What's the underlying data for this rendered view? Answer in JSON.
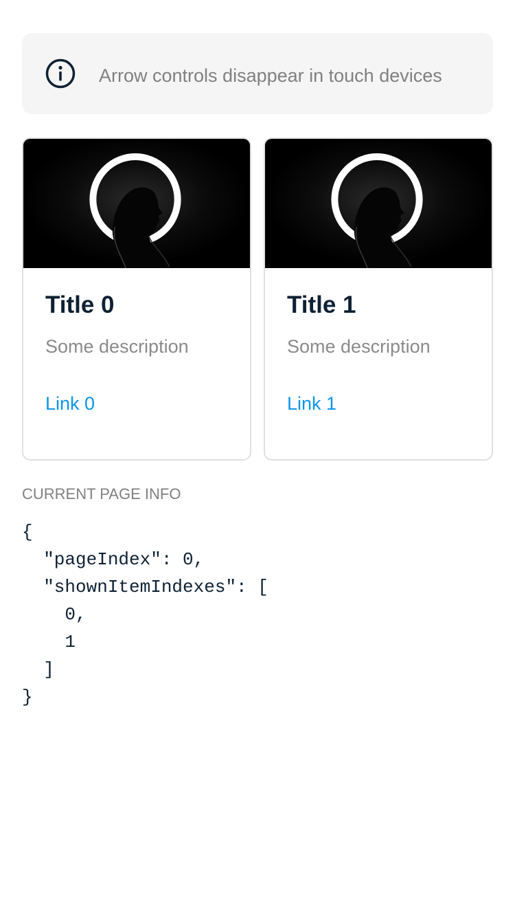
{
  "alert": {
    "icon": "info-icon",
    "text": "Arrow controls disappear in touch devices"
  },
  "cards": [
    {
      "title": "Title 0",
      "description": "Some description",
      "link": "Link 0"
    },
    {
      "title": "Title 1",
      "description": "Some description",
      "link": "Link 1"
    }
  ],
  "page_info": {
    "label": "CURRENT PAGE INFO",
    "json": "{\n  \"pageIndex\": 0,\n  \"shownItemIndexes\": [\n    0,\n    1\n  ]\n}"
  },
  "colors": {
    "link": "#0d95e8",
    "title": "#0f2133",
    "muted": "#808080",
    "alert_bg": "#f5f5f5",
    "border": "#e0e0e0"
  }
}
